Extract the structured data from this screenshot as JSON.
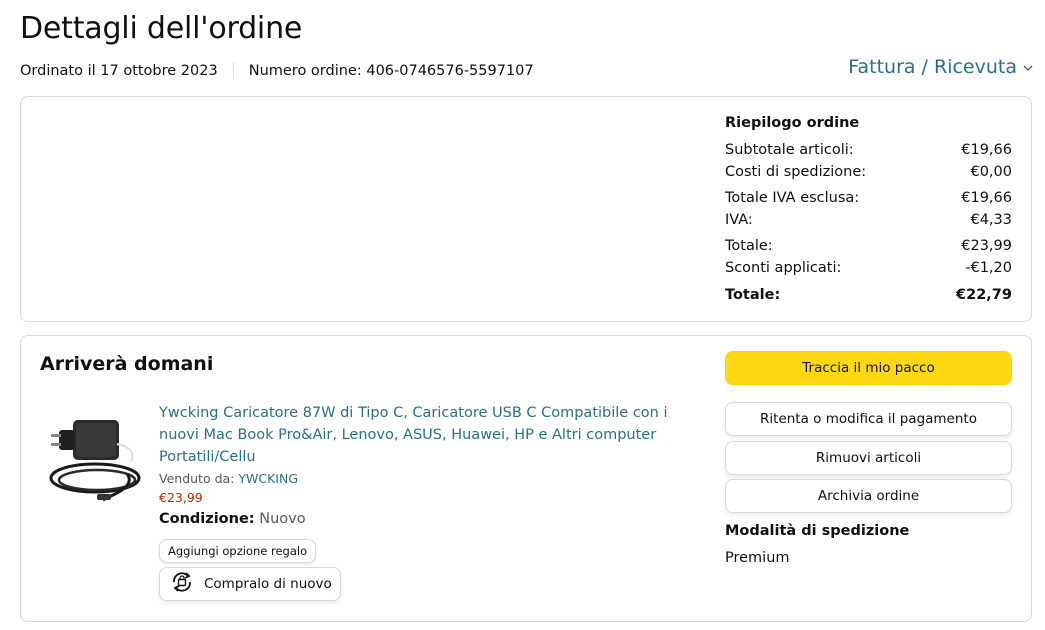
{
  "header": {
    "title": "Dettagli dell'ordine",
    "ordered_on": "Ordinato il 17 ottobre 2023",
    "order_number": "Numero ordine: 406-0746576-5597107",
    "invoice_link": "Fattura / Ricevuta"
  },
  "summary": {
    "title": "Riepilogo ordine",
    "rows": [
      {
        "label": "Subtotale articoli:",
        "value": "€19,66"
      },
      {
        "label": "Costi di spedizione:",
        "value": "€0,00"
      },
      {
        "label": "Totale IVA esclusa:",
        "value": "€19,66"
      },
      {
        "label": "IVA:",
        "value": "€4,33"
      },
      {
        "label": "Totale:",
        "value": "€23,99"
      },
      {
        "label": "Sconti applicati:",
        "value": "-€1,20"
      }
    ],
    "grand_total": {
      "label": "Totale:",
      "value": "€22,79"
    }
  },
  "shipment": {
    "arrival": "Arriverà domani",
    "product": {
      "title": "Ywcking Caricatore 87W di Tipo C, Caricatore USB C Compatibile con i nuovi Mac Book Pro&Air, Lenovo, ASUS, Huawei, HP e Altri computer Portatili/Cellu",
      "sold_by_label": "Venduto da:",
      "seller": "YWCKING",
      "price": "€23,99",
      "condition_label": "Condizione:",
      "condition_value": "Nuovo",
      "gift_option": "Aggiungi opzione regalo",
      "buy_again": "Compralo di nuovo"
    },
    "actions": {
      "track": "Traccia il mio pacco",
      "retry_payment": "Ritenta o modifica il pagamento",
      "remove_items": "Rimuovi articoli",
      "archive": "Archivia ordine"
    },
    "shipping_mode_label": "Modalità di spedizione",
    "shipping_mode_value": "Premium"
  },
  "colors": {
    "link": "#2b6f84",
    "price": "#b12704",
    "primary_button": "#ffd814",
    "border": "#d5d9d9"
  },
  "icons": [
    "chevron-down-icon",
    "buy-again-icon",
    "product-image"
  ]
}
